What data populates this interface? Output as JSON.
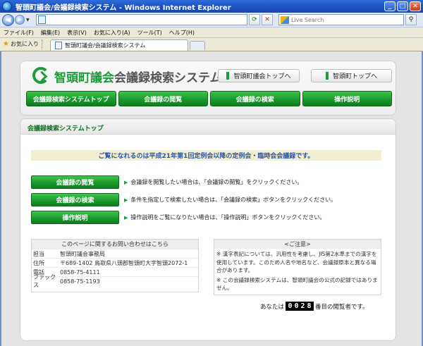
{
  "window": {
    "title": "智頭町議会/会議録検索システム - Windows Internet Explorer"
  },
  "browser": {
    "search_placeholder": "Live Search",
    "menu": [
      "ファイル(F)",
      "編集(E)",
      "表示(V)",
      "お気に入り(A)",
      "ツール(T)",
      "ヘルプ(H)"
    ],
    "favorites_label": "お気に入り",
    "tab_title": "智頭町議会/会議録検索システム"
  },
  "site": {
    "logo_primary": "智頭町議会",
    "logo_secondary": "会議録検索システム",
    "header_links": {
      "council": "智頭町議会トップへ",
      "town": "智頭町トップへ"
    },
    "nav": [
      "会議録検索システムトップ",
      "会議録の閲覧",
      "会議録の検索",
      "操作説明"
    ],
    "panel_title": "会議録検索システムトップ",
    "notice": "ご覧になれるのは平成21年第1回定例会以降の定例会・臨時会会議録です。",
    "actions": [
      {
        "label": "会議録の閲覧",
        "desc": "会議録を閲覧したい場合は、「会議録の閲覧」をクリックください。"
      },
      {
        "label": "会議録の検索",
        "desc": "条件を指定して検索したい場合は、「会議録の検索」ボタンをクリックください。"
      },
      {
        "label": "操作説明",
        "desc": "操作説明をご覧になりたい場合は、「操作説明」ボタンをクリックください。"
      }
    ],
    "contact": {
      "heading": "このページに関するお問い合わせはこちら",
      "rows": [
        {
          "label": "担当",
          "value": "智頭町議会事務局"
        },
        {
          "label": "住所",
          "value": "〒689-1402 鳥取県八頭郡智頭町大字智頭2072-1"
        },
        {
          "label": "電話",
          "value": "0858-75-4111"
        },
        {
          "label": "ファックス",
          "value": "0858-75-1193"
        }
      ]
    },
    "caution": {
      "heading": "<ご注意>",
      "notes": [
        "※ 漢字表記については、汎用性を考慮し、JIS第2水準までの漢字を使用しています。このため人名や地名など、会議録原本と異なる場合があります。",
        "※ この会議録検索システムは、智頭町議会の公式の記録ではありません。"
      ]
    },
    "visitor": {
      "prefix": "あなたは",
      "digits": [
        "0",
        "0",
        "2",
        "8"
      ],
      "suffix": "番目の閲覧者です。"
    }
  }
}
